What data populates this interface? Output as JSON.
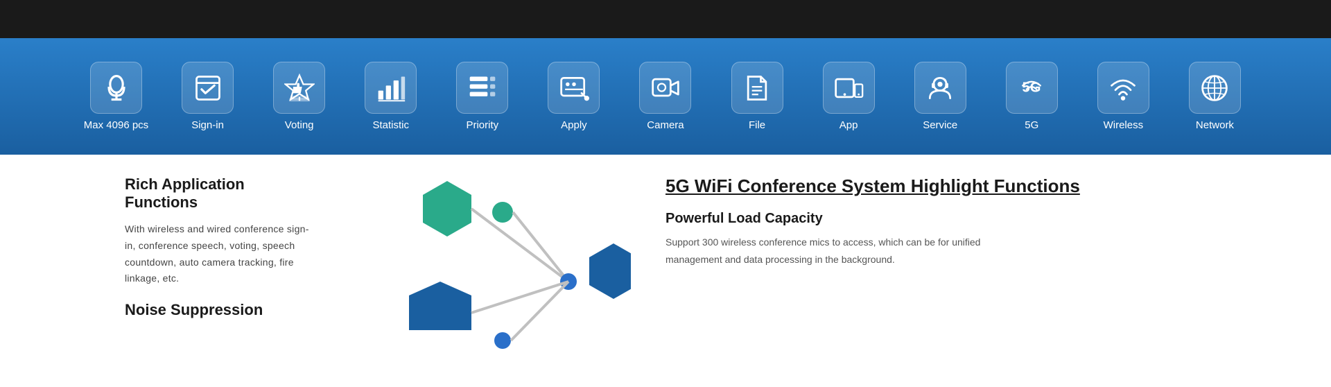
{
  "topBar": {
    "background": "#1a1a1a"
  },
  "iconBar": {
    "items": [
      {
        "id": "max4096",
        "label": "Max 4096 pcs",
        "icon": "microphone"
      },
      {
        "id": "signin",
        "label": "Sign-in",
        "icon": "signin"
      },
      {
        "id": "voting",
        "label": "Voting",
        "icon": "voting"
      },
      {
        "id": "statistic",
        "label": "Statistic",
        "icon": "statistic"
      },
      {
        "id": "priority",
        "label": "Priority",
        "icon": "priority"
      },
      {
        "id": "apply",
        "label": "Apply",
        "icon": "apply"
      },
      {
        "id": "camera",
        "label": "Camera",
        "icon": "camera"
      },
      {
        "id": "file",
        "label": "File",
        "icon": "file"
      },
      {
        "id": "app",
        "label": "App",
        "icon": "app"
      },
      {
        "id": "service",
        "label": "Service",
        "icon": "service"
      },
      {
        "id": "5g",
        "label": "5G",
        "icon": "5g"
      },
      {
        "id": "wireless",
        "label": "Wireless",
        "icon": "wireless"
      },
      {
        "id": "network",
        "label": "Network",
        "icon": "network"
      }
    ]
  },
  "leftSection": {
    "title1": "Rich Application Functions",
    "description1": "With wireless and wired conference sign-in, conference speech, voting, speech countdown, auto camera tracking, fire linkage, etc.",
    "title2": "Noise Suppression"
  },
  "rightSection": {
    "mainTitle": "5G WiFi Conference System  Highlight Functions",
    "subTitle": "Powerful Load Capacity",
    "description": "Support 300 wireless conference mics to access, which can be  for unified management and data processing in the background."
  }
}
